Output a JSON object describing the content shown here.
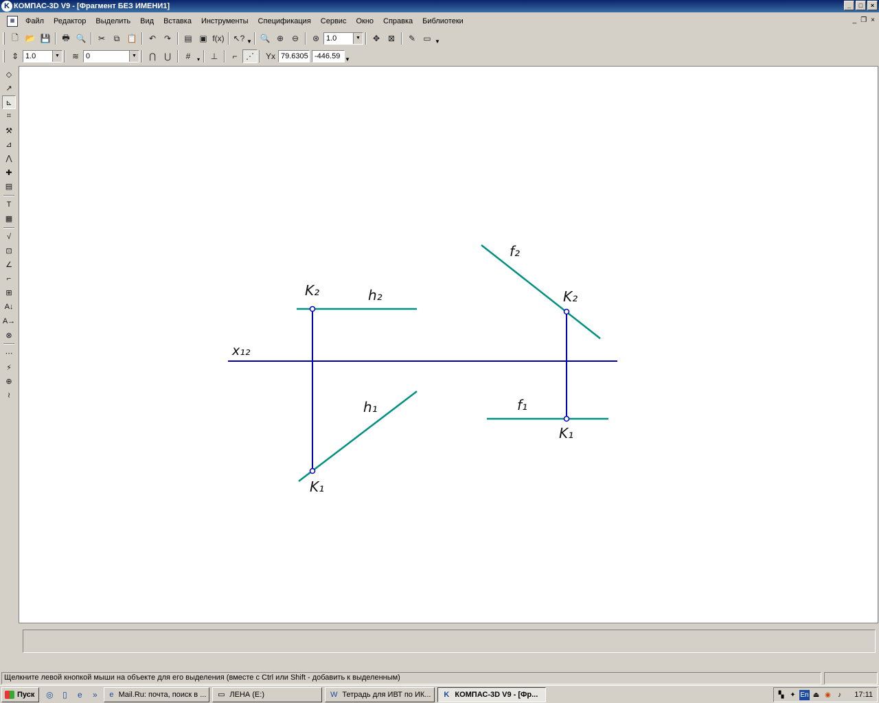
{
  "window": {
    "title": "КОМПАС-3D V9 - [Фрагмент БЕЗ ИМЕНИ1]",
    "controls": {
      "minimize": "_",
      "maximize": "□",
      "close": "×"
    }
  },
  "menu": {
    "items": [
      "Файл",
      "Редактор",
      "Выделить",
      "Вид",
      "Вставка",
      "Инструменты",
      "Спецификация",
      "Сервис",
      "Окно",
      "Справка",
      "Библиотеки"
    ],
    "mdi_controls": {
      "minimize": "_",
      "restore": "❐",
      "close": "×"
    }
  },
  "toolbar_standard": {
    "zoom_value": "1.0"
  },
  "toolbar_current_state": {
    "step_value": "1.0",
    "layer_value": "0",
    "coord_x": "79.6305",
    "coord_y": "-446.59"
  },
  "drawing": {
    "labels": {
      "x12": "x₁₂",
      "h2": "h₂",
      "h1": "h₁",
      "k2_left": "K₂",
      "k1_left": "K₁",
      "f2": "f₂",
      "f1": "f₁",
      "k2_right": "K₂",
      "k1_right": "K₁"
    },
    "colors": {
      "axis": "#0000a0",
      "lines": "#009080",
      "connector": "#0000c0"
    }
  },
  "statusbar": {
    "message": "Щелкните левой кнопкой мыши на объекте для его выделения (вместе с Ctrl или Shift - добавить к выделенным)"
  },
  "taskbar": {
    "start_label": "Пуск",
    "more": "»",
    "tasks": [
      {
        "label": "Mail.Ru: почта, поиск в ..."
      },
      {
        "label": "ЛЕНА (E:)"
      },
      {
        "label": "Тетрадь для ИВТ по ИК..."
      },
      {
        "label": "КОМПАС-3D V9 - [Фр..."
      }
    ],
    "tray": {
      "language": "En",
      "time": "17:11"
    }
  }
}
